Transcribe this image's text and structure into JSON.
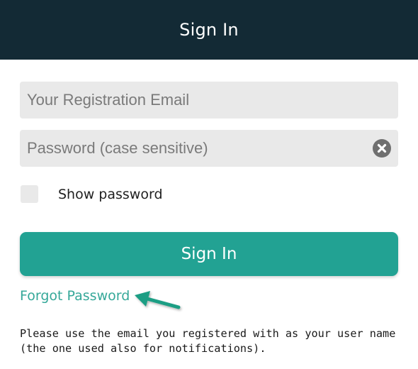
{
  "header": {
    "title": "Sign In"
  },
  "form": {
    "email": {
      "placeholder": "Your Registration Email",
      "value": ""
    },
    "password": {
      "placeholder": "Password (case sensitive)",
      "value": "",
      "clear_icon": "clear-circle-x-icon"
    },
    "show_password": {
      "label": "Show password",
      "checked": false
    },
    "submit_label": "Sign In",
    "forgot_label": "Forgot Password",
    "annotation_icon": "green-arrow-icon"
  },
  "help_text": "Please use the email you registered with as your user name (the one used also for notifications).",
  "colors": {
    "header_bg": "#132a35",
    "accent": "#22a293",
    "link": "#35a899",
    "field_bg": "#e9e9e9"
  }
}
